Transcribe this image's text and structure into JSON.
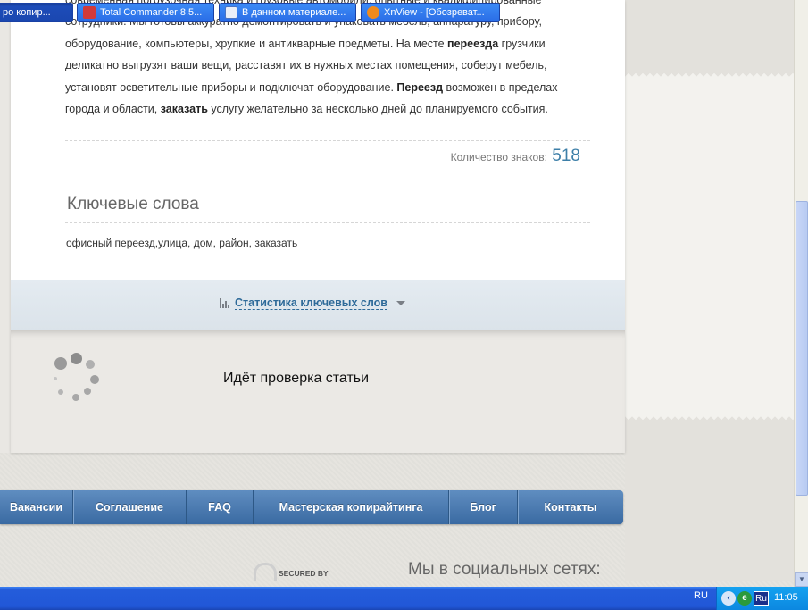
{
  "article": {
    "line0": "современная погрузочная техника и грузовые автомобили, опытные и квалифицированные",
    "line1": "сотрудники. Мы готовы аккуратно демонтировать и упаковать мебель, аппаратуру, прибору,",
    "line2_a": "оборудование, компьютеры, хрупкие и антикварные предметы. На месте ",
    "line2_b": "переезда",
    "line2_c": " грузчики",
    "line3": "деликатно выгрузят ваши вещи, расставят их в нужных местах помещения, соберут мебель,",
    "line4_a": "установят осветительные приборы и подключат оборудование. ",
    "line4_b": "Переезд",
    "line4_c": " возможен в пределах",
    "line5_a": "города и области, ",
    "line5_b": "заказать",
    "line5_c": " услугу желательно за несколько дней до планируемого события."
  },
  "char_count": {
    "label": "Количество знаков:",
    "value": "518"
  },
  "keywords": {
    "title": "Ключевые слова",
    "list": "офисный переезд,улица, дом, район, заказать"
  },
  "stats": {
    "link_label": "Статистика ключевых слов"
  },
  "check": {
    "status_text": "Идёт проверка статьи"
  },
  "nav": {
    "items": [
      {
        "label": "Вакансии"
      },
      {
        "label": "Соглашение"
      },
      {
        "label": "FAQ"
      },
      {
        "label": "Мастерская копирайтинга"
      },
      {
        "label": "Блог"
      },
      {
        "label": "Контакты"
      }
    ]
  },
  "footer": {
    "secured_label": "SECURED BY",
    "social_title": "Мы в социальных сетях:"
  },
  "taskbar": {
    "tasks": [
      {
        "label": "ро копир..."
      },
      {
        "label": "Total Commander 8.5..."
      },
      {
        "label": "В данном материале..."
      },
      {
        "label": "XnView - [Обозреват..."
      }
    ],
    "language": "RU",
    "tray_lang": "Ru",
    "tray_e": "e",
    "time": "11:05"
  },
  "colors": {
    "accent": "#3d7fa8",
    "nav_bg": "#4a78b0",
    "link": "#2e6a99",
    "taskbar": "#245ddb"
  }
}
